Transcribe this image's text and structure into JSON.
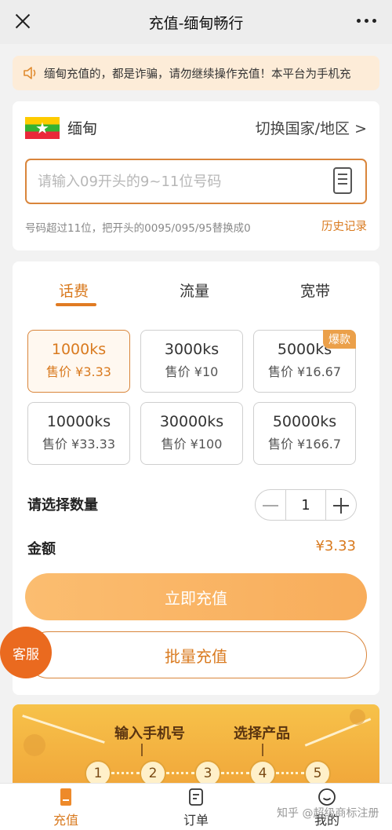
{
  "topbar": {
    "title": "充值-缅甸畅行"
  },
  "notice": {
    "text": "缅甸充值的，都是诈骗，请勿继续操作充值！本平台为手机充"
  },
  "region": {
    "country": "缅甸",
    "switch_label": "切换国家/地区 >",
    "phone_placeholder": "请输入09开头的9~11位号码",
    "hint": "号码超过11位，把开头的0095/095/95替换成0",
    "history_link": "历史记录"
  },
  "tabs": [
    {
      "label": "话费",
      "active": true
    },
    {
      "label": "流量",
      "active": false
    },
    {
      "label": "宽带",
      "active": false
    }
  ],
  "packages": [
    {
      "amount": "1000ks",
      "price": "售价 ¥3.33",
      "selected": true,
      "badge": ""
    },
    {
      "amount": "3000ks",
      "price": "售价 ¥10",
      "selected": false,
      "badge": ""
    },
    {
      "amount": "5000ks",
      "price": "售价 ¥16.67",
      "selected": false,
      "badge": "爆款"
    },
    {
      "amount": "10000ks",
      "price": "售价 ¥33.33",
      "selected": false,
      "badge": ""
    },
    {
      "amount": "30000ks",
      "price": "售价 ¥100",
      "selected": false,
      "badge": ""
    },
    {
      "amount": "50000ks",
      "price": "售价 ¥166.7",
      "selected": false,
      "badge": ""
    }
  ],
  "quantity": {
    "label": "请选择数量",
    "value": "1"
  },
  "total": {
    "label": "金额",
    "value": "¥3.33"
  },
  "buttons": {
    "recharge": "立即充值",
    "batch": "批量充值"
  },
  "support": {
    "label": "客服"
  },
  "banner": {
    "steps": [
      "输入手机号",
      "选择产品"
    ],
    "numbers": [
      "1",
      "2",
      "3",
      "4",
      "5"
    ]
  },
  "tabbar": [
    {
      "label": "充值",
      "active": true,
      "icon": "recharge-icon"
    },
    {
      "label": "订单",
      "active": false,
      "icon": "order-icon"
    },
    {
      "label": "我的",
      "active": false,
      "icon": "profile-icon"
    }
  ],
  "watermark": "知乎 @超级商标注册",
  "colors": {
    "accent": "#d97a1f",
    "notice_bg": "#fdecd8",
    "support": "#ea6a1f"
  }
}
